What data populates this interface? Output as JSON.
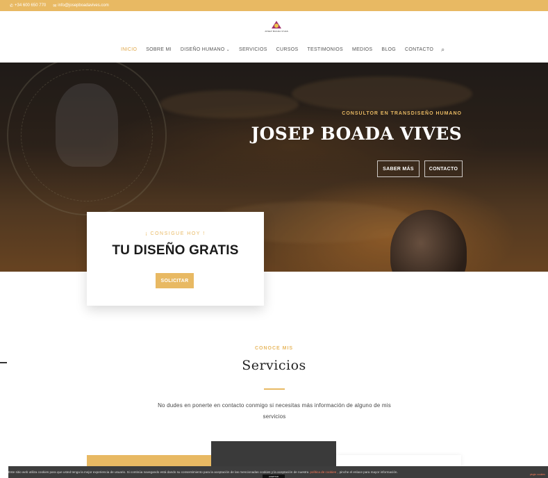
{
  "topbar": {
    "phone": "+34 600 650 770",
    "email": "info@josepboadavives.com",
    "phone_icon": "phone-icon",
    "email_icon": "mail-icon"
  },
  "logo": {
    "text": "JOSEP BOADA VIVES"
  },
  "nav": {
    "items": [
      {
        "label": "Inicio",
        "active": true
      },
      {
        "label": "Sobre mi",
        "active": false
      },
      {
        "label": "Diseño Humano",
        "active": false,
        "dropdown": true
      },
      {
        "label": "Servicios",
        "active": false
      },
      {
        "label": "Cursos",
        "active": false
      },
      {
        "label": "Testimonios",
        "active": false
      },
      {
        "label": "Medios",
        "active": false
      },
      {
        "label": "Blog",
        "active": false
      },
      {
        "label": "Contacto",
        "active": false
      }
    ],
    "search_icon": "search-icon"
  },
  "hero": {
    "subtitle": "Consultor en Transdiseño Humano",
    "title": "JOSEP BOADA VIVES",
    "btn_more": "Saber más",
    "btn_contact": "Contacto"
  },
  "promo": {
    "subtitle": "¡ Consigue hoy !",
    "title": "TU DISEÑO GRATIS",
    "button": "Solicitar"
  },
  "services": {
    "subtitle": "Conoce mis",
    "title": "Servicios",
    "description": "No dudes en ponerte en contacto conmigo si necesitas más información de alguno de mis servicios"
  },
  "cookie": {
    "text_before": "Este sitio web utiliza cookies para que usted tenga la mejor experiencia de usuario. Si continúa navegando está dando su consentimiento para la aceptación de las mencionadas cookies y la aceptación de nuestra",
    "link": "política de cookies",
    "text_after": ", pinche el enlace para mayor información.",
    "accept": "ACEPTAR",
    "more": "plugin cookies"
  },
  "colors": {
    "accent": "#e8b963",
    "nav_active": "#e0a84a",
    "cookie_bg": "#3d3d3d",
    "cookie_link": "#ff7a59"
  }
}
